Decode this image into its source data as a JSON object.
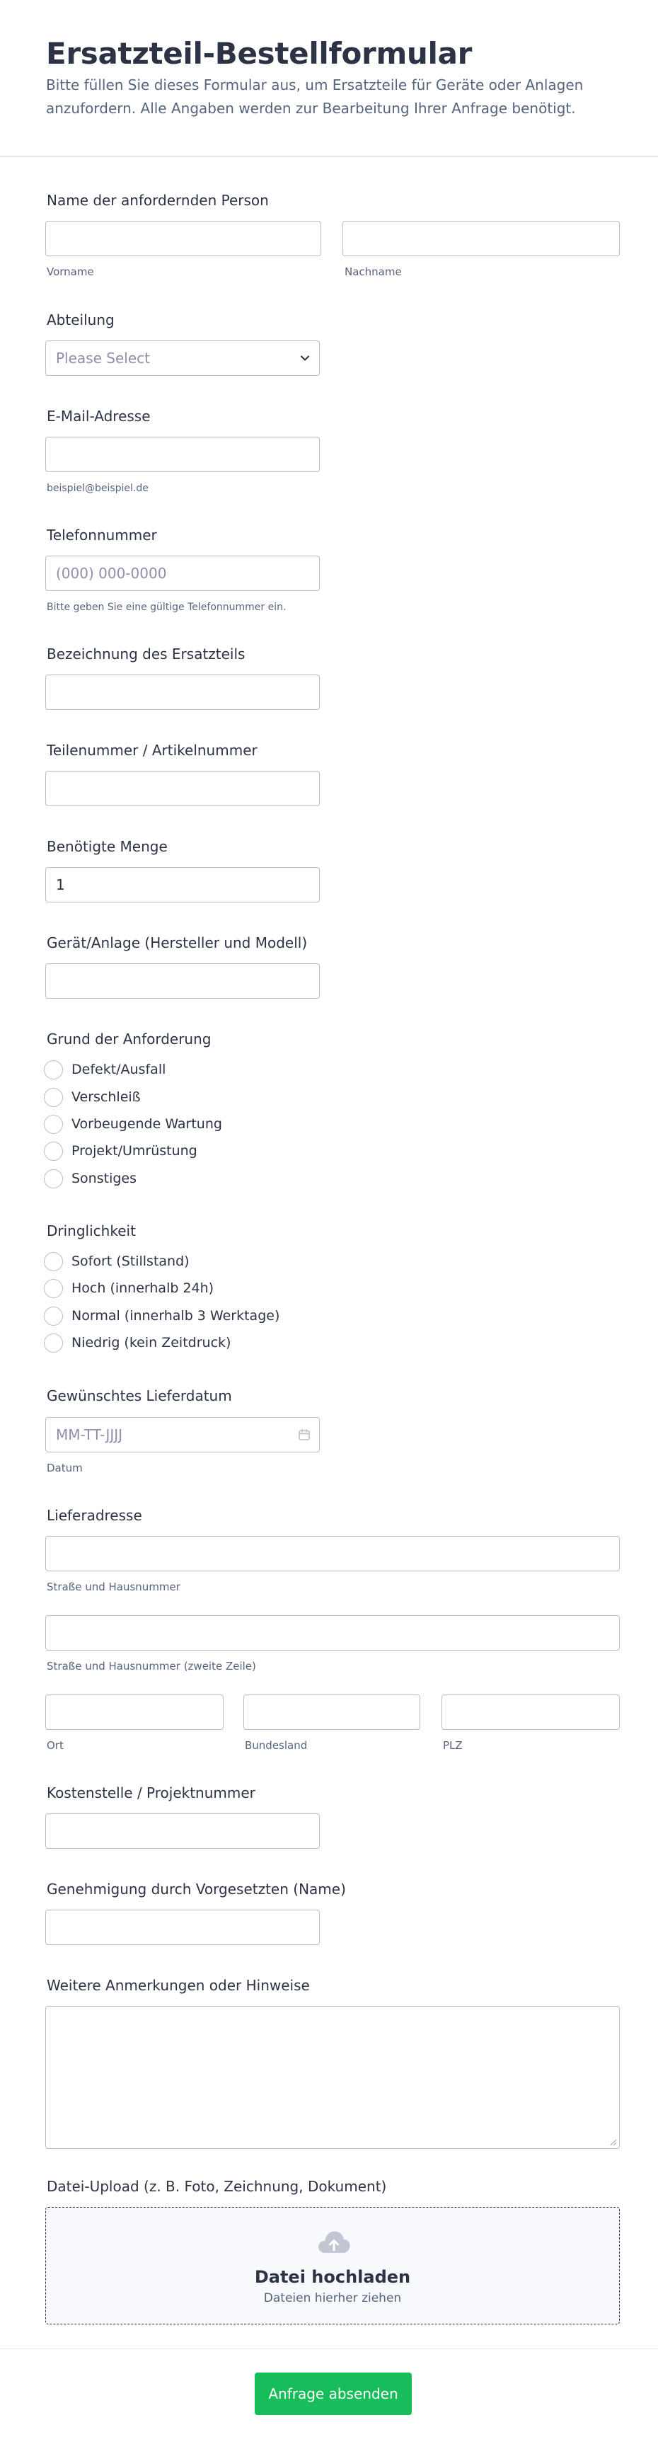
{
  "header": {
    "title": "Ersatzteil-Bestellformular",
    "subtitle": "Bitte füllen Sie dieses Formular aus, um Ersatzteile für Geräte oder Anlagen anzufordern. Alle Angaben werden zur Bearbeitung Ihrer Anfrage benötigt."
  },
  "name": {
    "label": "Name der anfordernden Person",
    "first_sublabel": "Vorname",
    "last_sublabel": "Nachname"
  },
  "department": {
    "label": "Abteilung",
    "placeholder": "Please Select"
  },
  "email": {
    "label": "E-Mail-Adresse",
    "sublabel": "beispiel@beispiel.de"
  },
  "phone": {
    "label": "Telefonnummer",
    "placeholder": "(000) 000-0000",
    "sublabel": "Bitte geben Sie eine gültige Telefonnummer ein."
  },
  "part_name": {
    "label": "Bezeichnung des Ersatzteils"
  },
  "part_number": {
    "label": "Teilenummer / Artikelnummer"
  },
  "quantity": {
    "label": "Benötigte Menge",
    "value": "1"
  },
  "device": {
    "label": "Gerät/Anlage (Hersteller und Modell)"
  },
  "reason": {
    "label": "Grund der Anforderung",
    "options": [
      "Defekt/Ausfall",
      "Verschleiß",
      "Vorbeugende Wartung",
      "Projekt/Umrüstung",
      "Sonstiges"
    ]
  },
  "urgency": {
    "label": "Dringlichkeit",
    "options": [
      "Sofort (Stillstand)",
      "Hoch (innerhalb 24h)",
      "Normal (innerhalb 3 Werktage)",
      "Niedrig (kein Zeitdruck)"
    ]
  },
  "delivery_date": {
    "label": "Gewünschtes Lieferdatum",
    "placeholder": "MM-TT-JJJJ",
    "sublabel": "Datum"
  },
  "address": {
    "label": "Lieferadresse",
    "street_sublabel": "Straße und Hausnummer",
    "street2_sublabel": "Straße und Hausnummer (zweite Zeile)",
    "city_sublabel": "Ort",
    "state_sublabel": "Bundesland",
    "zip_sublabel": "PLZ"
  },
  "cost_center": {
    "label": "Kostenstelle / Projektnummer"
  },
  "approval": {
    "label": "Genehmigung durch Vorgesetzten (Name)"
  },
  "notes": {
    "label": "Weitere Anmerkungen oder Hinweise"
  },
  "upload": {
    "label": "Datei-Upload (z. B. Foto, Zeichnung, Dokument)",
    "title": "Datei hochladen",
    "subtitle": "Dateien hierher ziehen",
    "icon": "cloud-upload-icon"
  },
  "submit": {
    "label": "Anfrage absenden"
  },
  "colors": {
    "accent": "#18bd5b",
    "text": "#2c3345",
    "muted": "#57647e",
    "border": "#b8bdc9"
  }
}
